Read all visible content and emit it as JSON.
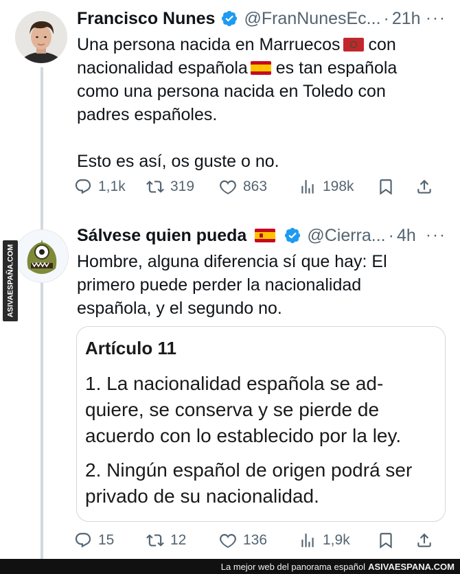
{
  "tweet1": {
    "name": "Francisco Nunes",
    "handle": "@FranNunesEc...",
    "separator": "·",
    "time": "21h",
    "more": "···",
    "line1_pre": "Una persona nacida en Marruecos",
    "line1_post": " con",
    "line2_pre": "nacionalidad española",
    "line2_post": " es tan española",
    "line3": "como una persona nacida en Toledo con",
    "line4": "padres españoles.",
    "line5": "Esto es así, os guste o no.",
    "stats": {
      "replies": "1,1k",
      "retweets": "319",
      "likes": "863",
      "views": "198k"
    }
  },
  "tweet2": {
    "name": "Sálvese quien pueda",
    "handle": "@Cierra...",
    "separator": "·",
    "time": "4h",
    "more": "···",
    "line1": "Hombre, alguna diferencia sí que hay: El",
    "line2": "primero puede perder la nacionalidad",
    "line3": "española, y el segundo no.",
    "card": {
      "title": "Artículo 11",
      "p1_l1": "1. La nacionalidad española se ad-",
      "p1_l2": "quiere, se conserva y se pierde de",
      "p1_l3": "acuerdo con lo establecido por la ley.",
      "p2_l1": "2. Ningún español de origen podrá ser",
      "p2_l2": "privado de su nacionalidad."
    },
    "stats": {
      "replies": "15",
      "retweets": "12",
      "likes": "136",
      "views": "1,9k"
    }
  },
  "watermark": {
    "side_text": "ASIVAESPAÑA.COM",
    "footer_text": "La mejor web del panorama español",
    "footer_brand": "ASIVAESPANA.COM"
  },
  "colors": {
    "text": "#0f1419",
    "muted": "#536471",
    "verified": "#1d9bf0",
    "divider": "#cfd9de"
  },
  "icons": [
    "reply-icon",
    "retweet-icon",
    "like-icon",
    "views-icon",
    "bookmark-icon",
    "share-icon",
    "verified-icon",
    "flag-morocco-icon",
    "flag-spain-icon"
  ]
}
